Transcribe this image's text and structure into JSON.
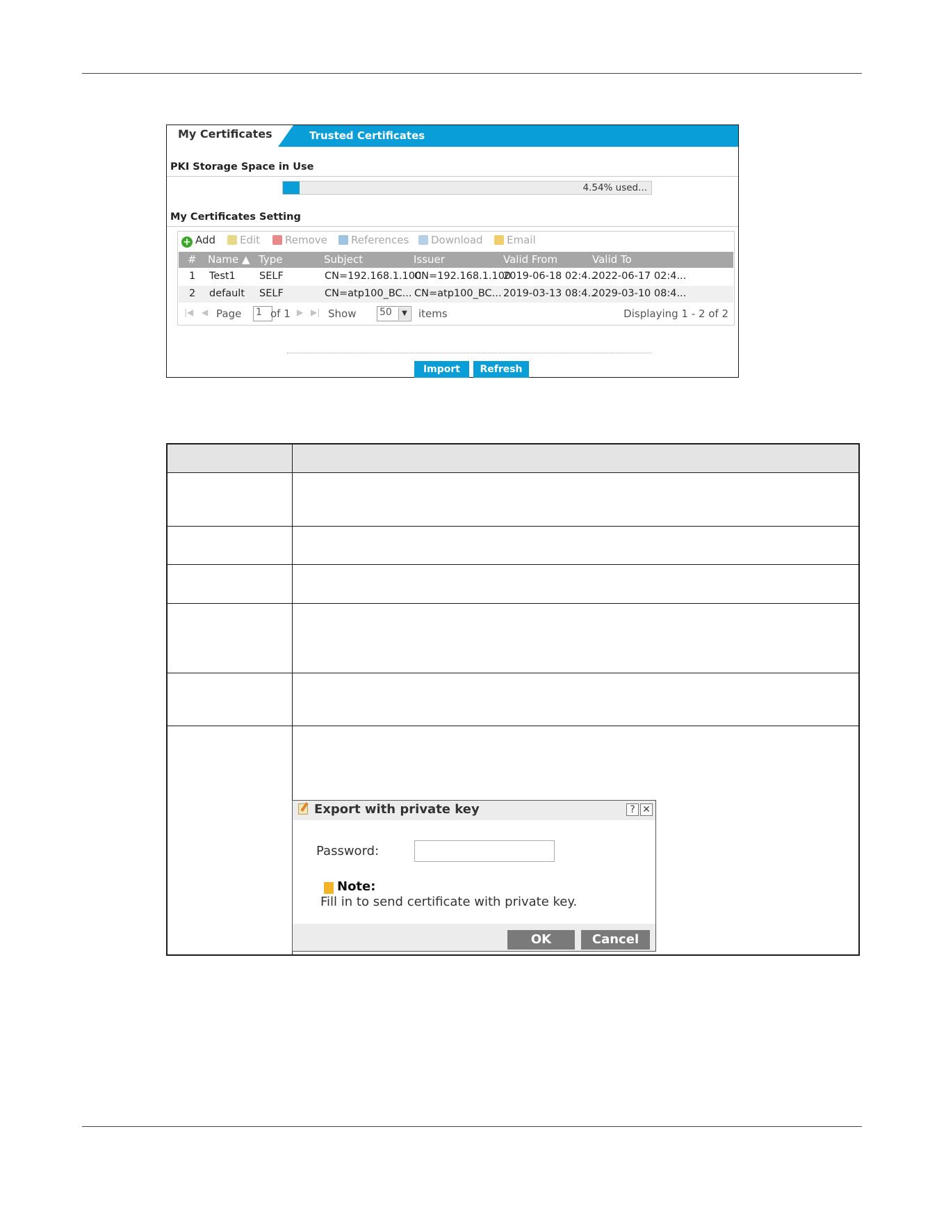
{
  "tabs": {
    "active": "My Certificates",
    "other": "Trusted Certificates"
  },
  "storage": {
    "section_title": "PKI Storage Space in Use",
    "used_text": "4.54% used...",
    "used_fraction": 0.0454
  },
  "settings": {
    "section_title": "My Certificates Setting"
  },
  "toolbar": {
    "add": "Add",
    "edit": "Edit",
    "remove": "Remove",
    "references": "References",
    "download": "Download",
    "email": "Email"
  },
  "grid": {
    "columns": [
      "#",
      "Name ▲",
      "Type",
      "Subject",
      "Issuer",
      "Valid From",
      "Valid To"
    ],
    "rows": [
      {
        "num": "1",
        "name": "Test1",
        "type": "SELF",
        "subject": "CN=192.168.1.100",
        "issuer": "CN=192.168.1.100",
        "valid_from": "2019-06-18 02:4...",
        "valid_to": "2022-06-17 02:4..."
      },
      {
        "num": "2",
        "name": "default",
        "type": "SELF",
        "subject": "CN=atp100_BC...",
        "issuer": "CN=atp100_BC...",
        "valid_from": "2019-03-13 08:4...",
        "valid_to": "2029-03-10 08:4..."
      }
    ]
  },
  "pager": {
    "page_label": "Page",
    "page_value": "1",
    "of_label": "of 1",
    "show_label": "Show",
    "show_value": "50",
    "items_label": "items",
    "displaying": "Displaying 1 - 2 of 2"
  },
  "buttons": {
    "import": "Import",
    "refresh": "Refresh"
  },
  "dialog": {
    "title": "Export with private key",
    "help": "?",
    "close": "✕",
    "password_label": "Password:",
    "note_title": "Note:",
    "note_text": "Fill in to send certificate with private key.",
    "ok": "OK",
    "cancel": "Cancel"
  },
  "colors": {
    "accent": "#0a9ed8",
    "header_gray": "#a6a6a6",
    "button_gray": "#7a7a7a",
    "add_green": "#3aa826"
  }
}
